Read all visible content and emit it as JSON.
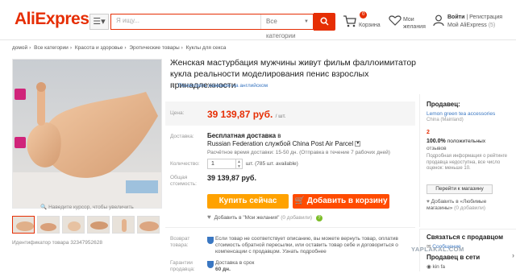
{
  "header": {
    "logo": "AliExpress",
    "search_placeholder": "Я ищу...",
    "search_category": "Все категории",
    "cart_count": "0",
    "cart_label": "Корзина",
    "wishlist_label": "Мои желания",
    "login": "Войти",
    "register": "Регистрация",
    "my_account": "Мой AliExpress",
    "my_account_count": "(5)"
  },
  "breadcrumbs": [
    "домой",
    "›",
    "Все категории",
    "›",
    "Красота и здоровье",
    "›",
    "Эротические товары",
    "›",
    "Куклы для секса"
  ],
  "gallery": {
    "zoom_hint": "Наведите курсор, чтобы увеличить",
    "product_id": "Идентификатор товара 32347952628",
    "thumb_count": 6
  },
  "product": {
    "title": "Женская мастурбация мужчины живут фильм фаллоимитатор кукла реальности моделирования пенис взрослых принадлежности",
    "translate_link": "Посмотреть название на английском",
    "price_label": "Цена:",
    "price": "39 139,87 руб.",
    "price_unit": "/ шт.",
    "shipping_label": "Доставка:",
    "shipping_free": "Бесплатная доставка",
    "shipping_to": "в",
    "shipping_carrier": "Russian Federation службой China Post Air Parcel",
    "shipping_time": "Расчётное время доставки: 15-50 дн. (Отправка в течение 7 рабочих дней)",
    "qty_label": "Количество:",
    "qty_value": "1",
    "qty_available": "шт. (785 шт. available)",
    "total_label": "Общая стоимость:",
    "total_value": "39 139,87 руб.",
    "buy_now": "Купить сейчас",
    "add_to_cart": "Добавить в корзину",
    "wishlist": "Добавить в \"Мои желания\"",
    "wishlist_count": "(0 добавили)",
    "return_label": "Возврат товара:",
    "return_text": "Если товар не соответствует описанию, вы можете вернуть товар, оплатив стоимость обратной пересылки, или оставить товар себе и договориться о компенсации с продавцом. Узнать подробнее",
    "guarantee_label": "Гарантии продавца:",
    "guarantee_text": "Доставка в срок",
    "guarantee_days": "60 дн."
  },
  "seller": {
    "header": "Продавец:",
    "name": "Lemon green tea accessories",
    "country": "China (Mainland)",
    "level": "2",
    "positive_pct": "100.0%",
    "positive_label": "положительных",
    "positive_label2": "отзывов",
    "info": "Подробная информация о рейтинге продавца недоступна, все число оценок: меньше 10.",
    "go_store": "Перейти к магазину",
    "fav": "Добавить в «Любимые магазины»",
    "fav_count": "(0 добавили)"
  },
  "contact": {
    "header": "Связаться с продавцом",
    "message": "Сообщение",
    "recent_header": "Продавец в сети",
    "user": "kin fa"
  },
  "watermark": "YAPLAKAL.COM",
  "colors": {
    "brand": "#e62e04",
    "buy_now": "#ffa200",
    "add_to_cart": "#ff4b00",
    "link": "#3a77c2"
  }
}
